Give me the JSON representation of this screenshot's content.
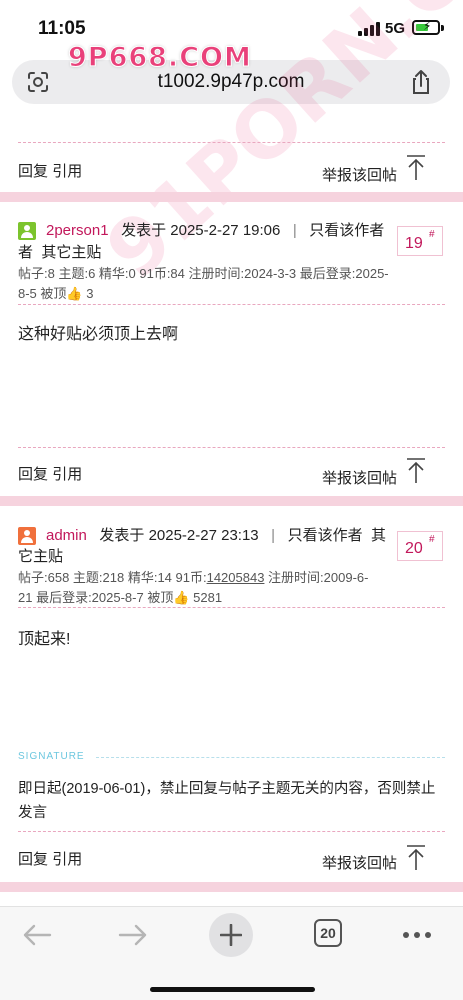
{
  "status_bar": {
    "time": "11:05",
    "network": "5G"
  },
  "browser": {
    "url": "t1002.9p47p.com",
    "watermark_top": "9P668.COM",
    "watermark_diag": "91PORN.COM",
    "tab_count": "20"
  },
  "post_actions": {
    "reply": "回复",
    "quote": "引用",
    "report": "举报该回帖"
  },
  "posts": [
    {
      "username": "2person1",
      "posted_label": "发表于",
      "posted_time": "2025-2-27 19:06",
      "separator": "|",
      "only_author": "只看该作者",
      "other_posts": "其它主贴",
      "floor": "19",
      "floor_mark": "#",
      "meta_line1": "帖子:8 主题:6 精华:0 91币:84  注册时间:2024-3-3 最后登录:2025-",
      "meta_line2_prefix": "8-5 被顶",
      "meta_likes": "3",
      "content": "这种好贴必须顶上去啊",
      "avatar_color": "#7cc42d"
    },
    {
      "username": "admin",
      "posted_label": "发表于",
      "posted_time": "2025-2-27 23:13",
      "separator": "|",
      "only_author": "只看该作者",
      "other_posts_a": "其",
      "other_posts_b": "它主贴",
      "floor": "20",
      "floor_mark": "#",
      "meta_line1_prefix": "帖子:658 主题:218 精华:14 91币:",
      "meta_coins": "14205843",
      "meta_line1_suffix": "  注册时间:2009-6-",
      "meta_line2_prefix": "21 最后登录:2025-8-7 被顶",
      "meta_likes": "5281",
      "content": "顶起来!",
      "signature_label": "SIGNATURE",
      "signature_line1": "即日起(2019-06-01)，禁止回复与帖子主题无关的内容，否则禁止",
      "signature_line2": "发言",
      "avatar_color": "#f0703c"
    }
  ],
  "icons": {
    "back": "back-arrow-icon",
    "forward": "forward-arrow-icon",
    "new_tab": "plus-icon",
    "tabs": "tabs-icon",
    "more": "more-icon",
    "thumbs_up": "thumbs-up-icon",
    "top": "back-to-top-icon"
  }
}
